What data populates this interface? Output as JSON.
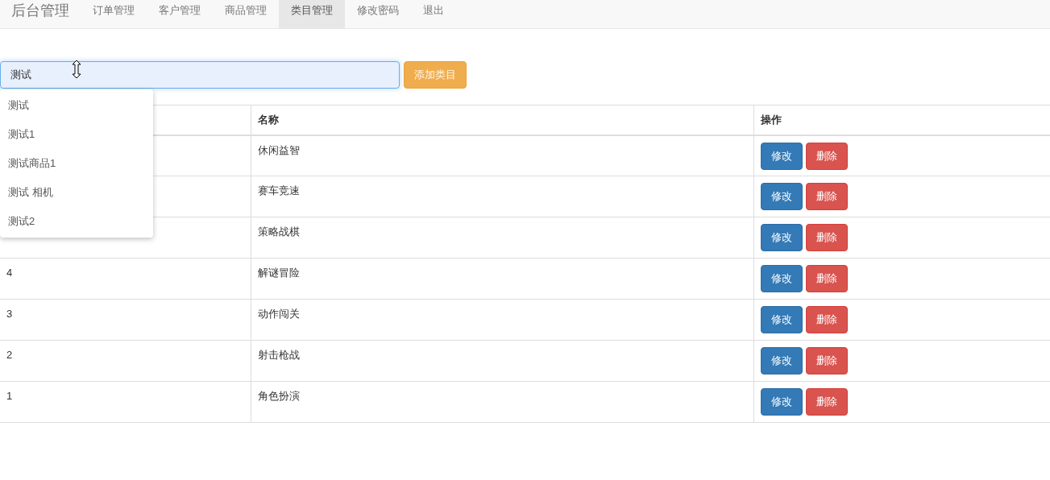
{
  "navbar": {
    "brand": "后台管理",
    "items": [
      {
        "label": "订单管理",
        "selected": false
      },
      {
        "label": "客户管理",
        "selected": false
      },
      {
        "label": "商品管理",
        "selected": false
      },
      {
        "label": "类目管理",
        "selected": true
      },
      {
        "label": "修改密码",
        "selected": false
      },
      {
        "label": "退出",
        "selected": false
      }
    ]
  },
  "add_form": {
    "value": "测试",
    "button": "添加类目"
  },
  "suggestions": [
    "测试",
    "测试1",
    "测试商品1",
    "测试 相机",
    "测试2"
  ],
  "table": {
    "columns": {
      "column_2": "名称",
      "column_3": "操作"
    },
    "rows": [
      {
        "name": "休闲益智",
        "actions": [
          "修改",
          "删除"
        ]
      },
      {
        "name": "赛车竞速",
        "actions": [
          "修改",
          "删除"
        ]
      },
      {
        "name": "策略战棋",
        "actions": [
          "修改",
          "删除"
        ]
      },
      {
        "id": "4",
        "name": "解谜冒险",
        "actions": [
          "修改",
          "删除"
        ]
      },
      {
        "id": "3",
        "name": "动作闯关",
        "actions": [
          "修改",
          "删除"
        ]
      },
      {
        "id": "2",
        "name": "射击枪战",
        "actions": [
          "修改",
          "删除"
        ]
      },
      {
        "id": "1",
        "name": "角色扮演",
        "actions": [
          "修改",
          "删除"
        ]
      }
    ]
  }
}
